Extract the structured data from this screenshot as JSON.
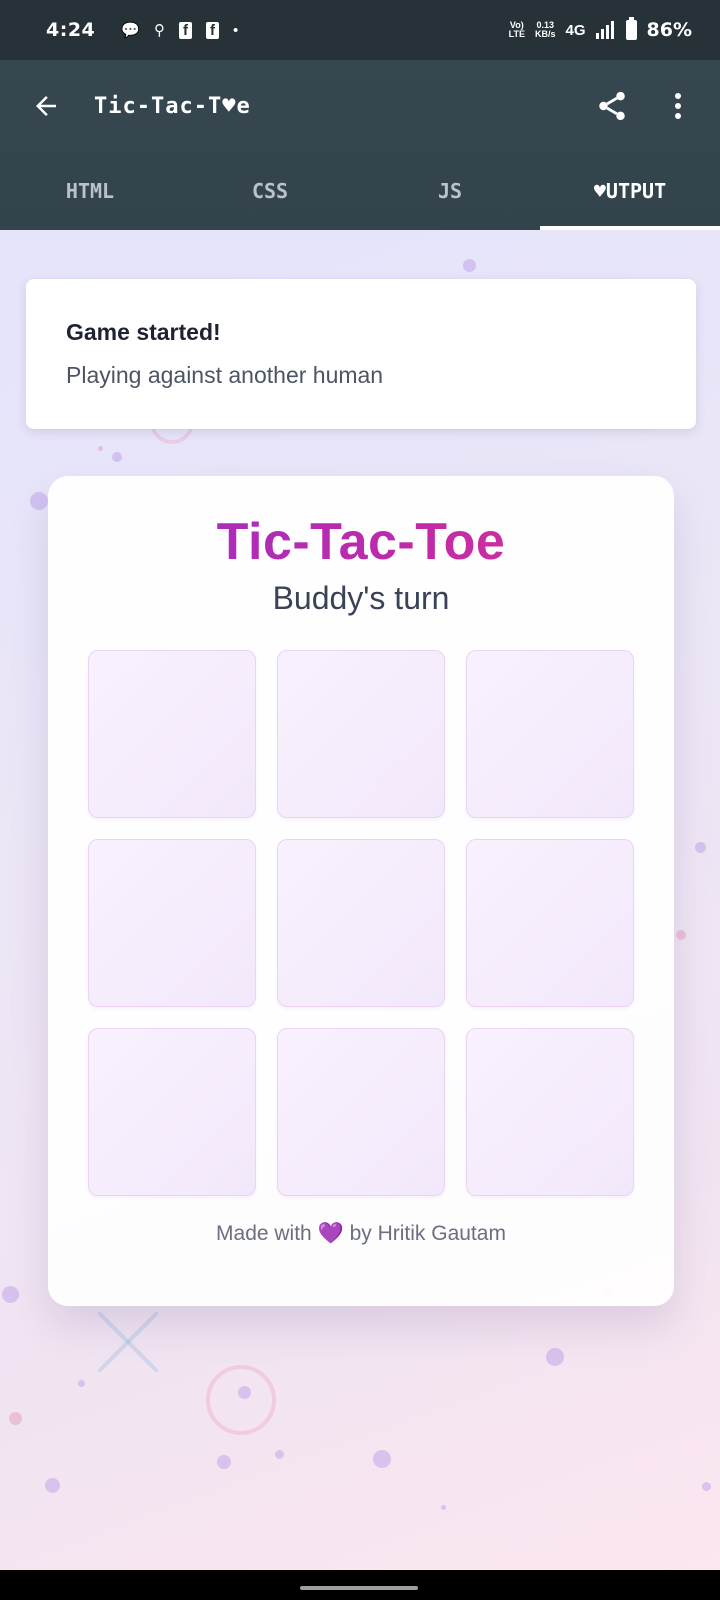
{
  "status_bar": {
    "time": "4:24",
    "notifications": [
      "💬",
      "⚲",
      "f",
      "f",
      "•"
    ],
    "volte_line1": "Vo)",
    "volte_line2": "LTE",
    "speed_line1": "0.13",
    "speed_line2": "KB/s",
    "network": "4G",
    "battery": "86%"
  },
  "app_bar": {
    "title": "Tic-Tac-T♥e",
    "tabs": [
      {
        "label": "HTML",
        "active": false
      },
      {
        "label": "CSS",
        "active": false
      },
      {
        "label": "JS",
        "active": false
      },
      {
        "label": "♥UTPUT",
        "active": true
      }
    ]
  },
  "toast": {
    "title": "Game started!",
    "message": "Playing against another human"
  },
  "game": {
    "title": "Tic-Tac-Toe",
    "turn": "Buddy's turn",
    "cells": [
      "",
      "",
      "",
      "",
      "",
      "",
      "",
      "",
      ""
    ],
    "footer_prefix": "Made with ",
    "footer_heart": "💜",
    "footer_suffix": " by Hritik Gautam"
  },
  "colors": {
    "status_bar": "#263238",
    "app_bar": "#37474f",
    "title_gradient_start": "#9b2fc8",
    "title_gradient_end": "#e0358c"
  },
  "icons": {
    "back": "arrow-left-icon",
    "share": "share-icon",
    "more": "more-vertical-icon"
  }
}
